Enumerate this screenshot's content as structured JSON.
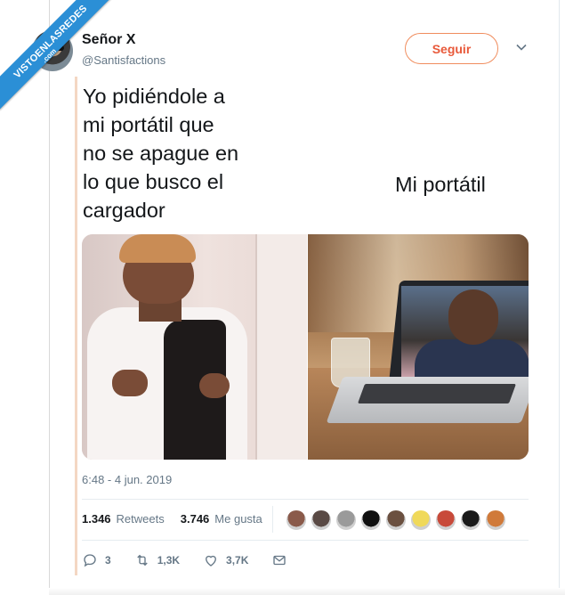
{
  "watermark": {
    "text": "VISTOENLASREDES",
    "sub": ".com",
    "color": "#2b8fd6"
  },
  "tweet": {
    "author": {
      "name": "Señor X",
      "handle": "@Santisfactions"
    },
    "follow_label": "Seguir",
    "text_left": "Yo pidiéndole a\nmi portátil que\nno se apague en\nlo que busco el\ncargador",
    "text_right": "Mi portátil",
    "timestamp": "6:48 - 4 jun. 2019",
    "stats": {
      "retweets_count": "1.346",
      "retweets_label": "Retweets",
      "likes_count": "3.746",
      "likes_label": "Me gusta"
    },
    "liker_colors": [
      "#8a5a4a",
      "#5a4a45",
      "#9a9a9a",
      "#111111",
      "#6b5040",
      "#f0d95a",
      "#c84a3a",
      "#1a1a1a",
      "#d07a3a"
    ],
    "actions": {
      "replies": "3",
      "retweets": "1,3K",
      "likes": "3,7K"
    }
  },
  "colors": {
    "accent_follow": "#e8593a",
    "text_primary": "#14171a",
    "text_secondary": "#657786"
  }
}
